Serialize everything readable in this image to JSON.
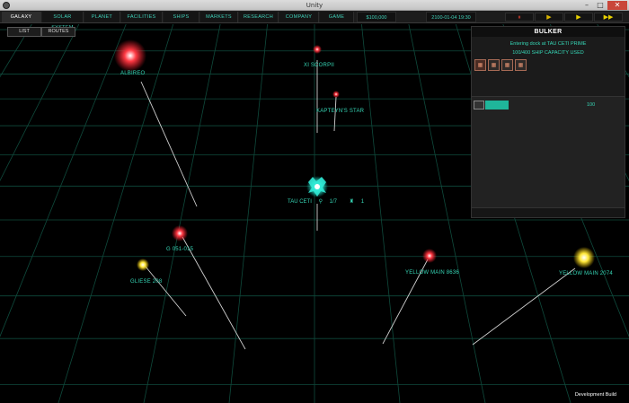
{
  "window": {
    "title": "Unity",
    "minimize": "–",
    "maximize": "□",
    "close": "✕"
  },
  "nav": {
    "items": [
      "GALAXY",
      "SOLAR SYSTEM",
      "PLANET",
      "FACILITIES",
      "SHIPS",
      "MARKETS",
      "RESEARCH",
      "COMPANY",
      "GAME"
    ],
    "active": "GALAXY",
    "money": "$100,000",
    "date": "2100-01-04 19:30",
    "speed_controls": [
      {
        "icon": "pause-icon",
        "glyph": "⏸",
        "color": "#c0392b"
      },
      {
        "icon": "play-slow-icon",
        "glyph": "▶",
        "color": "#d8b400"
      },
      {
        "icon": "play-icon",
        "glyph": "▶",
        "color": "#e8d000"
      },
      {
        "icon": "fast-forward-icon",
        "glyph": "▶▶",
        "color": "#e8d000"
      }
    ]
  },
  "view_tabs": [
    "LIST",
    "ROUTES"
  ],
  "stars": {
    "albireo": {
      "label": "ALBIREO",
      "color": "#ff2a36"
    },
    "xi_scorpii": {
      "label": "XI SCORPII",
      "color": "#ff4b4b"
    },
    "kapteyns_star": {
      "label": "KAPTEYN'S STAR",
      "color": "#ff4b4b"
    },
    "tau_ceti": {
      "label": "TAU CETI",
      "color": "#2fe8d0"
    },
    "g_051_015": {
      "label": "G 051-015",
      "color": "#ff2a36"
    },
    "gliese_208": {
      "label": "GLIESE 208",
      "color": "#ffe53a"
    },
    "yellow_main_8636": {
      "label": "YELLOW MAIN 8636",
      "color": "#ff2a36"
    },
    "yellow_main_2074": {
      "label": "YELLOW MAIN 2074",
      "color": "#fff23a"
    }
  },
  "tau_ceti_info": {
    "planets": "1/7",
    "facilities": "1"
  },
  "ship_panel": {
    "title": "BULKER",
    "status": "Entering dock at TAU CETI PRIME",
    "capacity": "100/400 SHIP CAPACITY USED",
    "cargo_slots": 4,
    "cargo_slots_filled": 1,
    "cargo_amount": "100"
  },
  "footer": {
    "dev_build": "Development Build"
  }
}
